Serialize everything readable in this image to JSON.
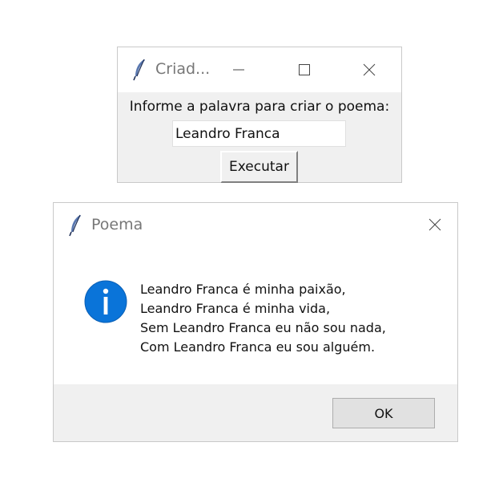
{
  "main_window": {
    "title": "Criad...",
    "icon": "feather-icon",
    "controls": {
      "minimize": "minimize-icon",
      "maximize": "maximize-icon",
      "close": "close-icon"
    },
    "prompt_label": "Informe a palavra para criar o poema:",
    "word_input_value": "Leandro Franca",
    "execute_label": "Executar"
  },
  "dialog": {
    "title": "Poema",
    "icon": "feather-icon",
    "info_icon": "info-icon",
    "info_icon_color": "#0a74d9",
    "message_lines": [
      "Leandro Franca é minha paixão,",
      "Leandro Franca é minha vida,",
      "Sem Leandro Franca eu não sou nada,",
      "Com Leandro Franca eu sou alguém."
    ],
    "ok_label": "OK"
  }
}
